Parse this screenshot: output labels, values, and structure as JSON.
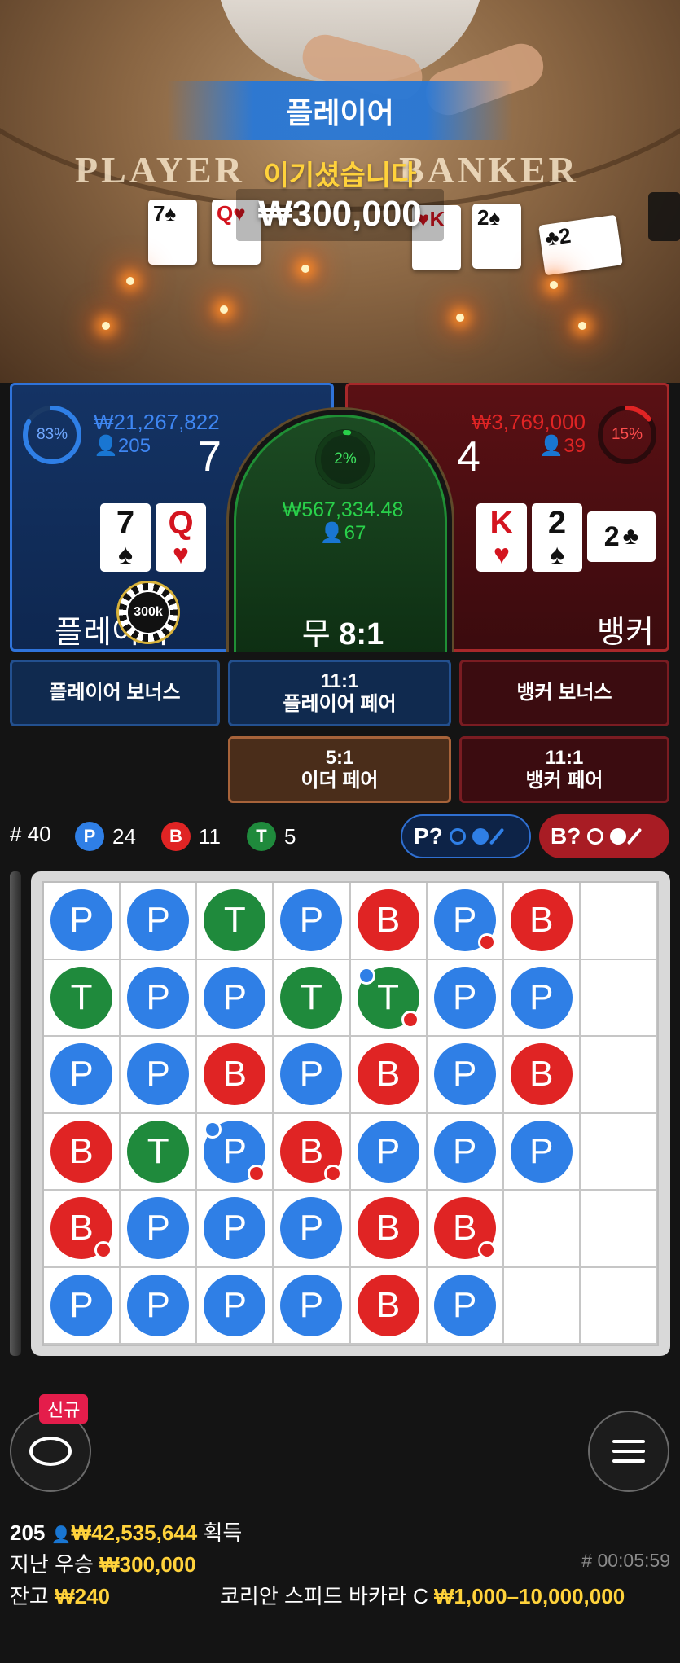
{
  "video": {
    "felt_left": "PLAYER",
    "felt_right": "BANKER",
    "result_banner": "플레이어",
    "win_message": "이기셨습니다",
    "win_amount": "₩300,000",
    "player_cards": [
      {
        "rank": "7",
        "suit": "♠",
        "color": "black"
      },
      {
        "rank": "Q",
        "suit": "♥",
        "color": "red"
      }
    ],
    "banker_cards": [
      {
        "rank": "K",
        "suit": "♥",
        "color": "red"
      },
      {
        "rank": "2",
        "suit": "♠",
        "color": "black"
      },
      {
        "rank": "2",
        "suit": "♣",
        "color": "black"
      }
    ]
  },
  "player": {
    "percent": "83%",
    "percent_value": 83,
    "total_bet": "₩21,267,822",
    "bettors": "205",
    "score": "7",
    "label": "플레이어",
    "chip": "300k",
    "cards": [
      {
        "rank": "7",
        "suit": "♠",
        "color": "black"
      },
      {
        "rank": "Q",
        "suit": "♥",
        "color": "red"
      }
    ]
  },
  "tie": {
    "percent": "2%",
    "percent_value": 2,
    "total_bet": "₩567,334.48",
    "bettors": "67",
    "label": "무",
    "payout": "8:1"
  },
  "banker": {
    "percent": "15%",
    "percent_value": 15,
    "total_bet": "₩3,769,000",
    "bettors": "39",
    "score": "4",
    "label": "뱅커",
    "cards": [
      {
        "rank": "K",
        "suit": "♥",
        "color": "red"
      },
      {
        "rank": "2",
        "suit": "♠",
        "color": "black"
      }
    ],
    "third_card": {
      "rank": "2",
      "suit": "♣",
      "color": "black"
    }
  },
  "side_bets": {
    "player_bonus": "플레이어 보너스",
    "player_pair_odds": "11:1",
    "player_pair": "플레이어 페어",
    "banker_bonus": "뱅커 보너스",
    "either_pair_odds": "5:1",
    "either_pair": "이더 페어",
    "banker_pair_odds": "11:1",
    "banker_pair": "뱅커 페어"
  },
  "stats": {
    "total_label": "# 40",
    "player_letter": "P",
    "player_count": "24",
    "banker_letter": "B",
    "banker_count": "11",
    "tie_letter": "T",
    "tie_count": "5",
    "player_ask": "P?",
    "banker_ask": "B?"
  },
  "road": [
    [
      "P",
      "P",
      "T",
      "P",
      "B",
      "P:br",
      "B",
      ""
    ],
    [
      "T",
      "P",
      "P",
      "T",
      "T:tl:br",
      "P",
      "P",
      ""
    ],
    [
      "P",
      "P",
      "B",
      "P",
      "B",
      "P",
      "B",
      ""
    ],
    [
      "B",
      "T",
      "P:tl:br",
      "B:br",
      "P",
      "P",
      "P",
      ""
    ],
    [
      "B:br",
      "P",
      "P",
      "P",
      "B",
      "B:br",
      "",
      ""
    ],
    [
      "P",
      "P",
      "P",
      "P",
      "B",
      "P",
      "",
      ""
    ]
  ],
  "bottom": {
    "new_badge": "신규",
    "players_count": "205",
    "total_winnings": "₩42,535,644",
    "winnings_label": "획득",
    "last_win_label": "지난 우승",
    "last_win_amount": "₩300,000",
    "round_id": "# 00:05:59",
    "balance_label": "잔고",
    "balance_amount": "₩240",
    "table_name": "코리안 스피드 바카라 C",
    "table_limits": "₩1,000–10,000,000"
  },
  "colors": {
    "player_blue": "#2f7fe6",
    "banker_red": "#e02424",
    "tie_green": "#1f8a3c",
    "gold": "#ffd23b"
  }
}
